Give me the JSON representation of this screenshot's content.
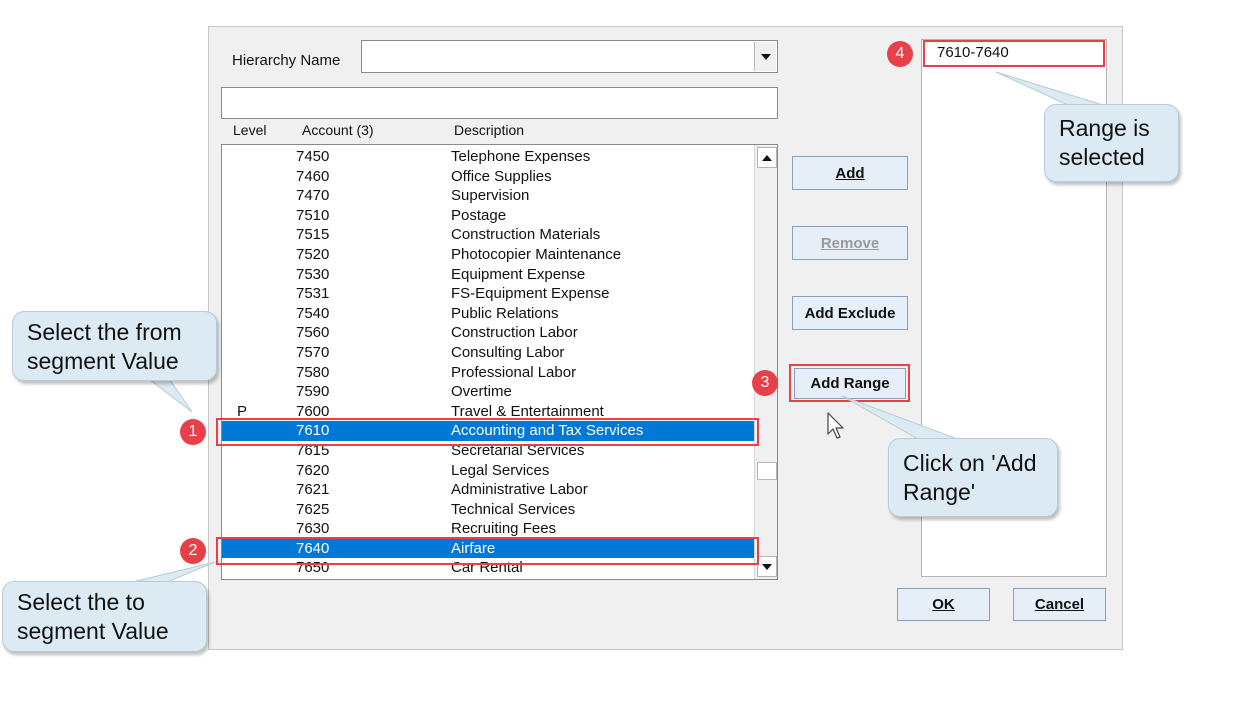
{
  "dialog": {
    "hierarchy_label": "Hierarchy Name",
    "hierarchy_value": "",
    "filter_value": "",
    "columns": {
      "level": "Level",
      "account": "Account (3)",
      "description": "Description"
    },
    "rows": [
      {
        "level": "",
        "account": "7450",
        "description": "Telephone Expenses",
        "selected": false
      },
      {
        "level": "",
        "account": "7460",
        "description": "Office Supplies",
        "selected": false
      },
      {
        "level": "",
        "account": "7470",
        "description": "Supervision",
        "selected": false
      },
      {
        "level": "",
        "account": "7510",
        "description": "Postage",
        "selected": false
      },
      {
        "level": "",
        "account": "7515",
        "description": "Construction Materials",
        "selected": false
      },
      {
        "level": "",
        "account": "7520",
        "description": "Photocopier Maintenance",
        "selected": false
      },
      {
        "level": "",
        "account": "7530",
        "description": "Equipment Expense",
        "selected": false
      },
      {
        "level": "",
        "account": "7531",
        "description": "FS-Equipment Expense",
        "selected": false
      },
      {
        "level": "",
        "account": "7540",
        "description": "Public Relations",
        "selected": false
      },
      {
        "level": "",
        "account": "7560",
        "description": "Construction Labor",
        "selected": false
      },
      {
        "level": "",
        "account": "7570",
        "description": "Consulting Labor",
        "selected": false
      },
      {
        "level": "",
        "account": "7580",
        "description": "Professional Labor",
        "selected": false
      },
      {
        "level": "",
        "account": "7590",
        "description": "Overtime",
        "selected": false
      },
      {
        "level": "P",
        "account": "7600",
        "description": "Travel & Entertainment",
        "selected": false
      },
      {
        "level": "",
        "account": "7610",
        "description": "Accounting and Tax Services",
        "selected": true
      },
      {
        "level": "",
        "account": "7615",
        "description": "Secretarial Services",
        "selected": false
      },
      {
        "level": "",
        "account": "7620",
        "description": "Legal Services",
        "selected": false
      },
      {
        "level": "",
        "account": "7621",
        "description": "Administrative Labor",
        "selected": false
      },
      {
        "level": "",
        "account": "7625",
        "description": "Technical Services",
        "selected": false
      },
      {
        "level": "",
        "account": "7630",
        "description": "Recruiting Fees",
        "selected": false
      },
      {
        "level": "",
        "account": "7640",
        "description": "Airfare",
        "selected": true
      },
      {
        "level": "",
        "account": "7650",
        "description": "Car Rental",
        "selected": false
      }
    ],
    "buttons": {
      "add": "Add",
      "remove": "Remove",
      "add_exclude": "Add Exclude",
      "add_range": "Add Range",
      "ok": "OK",
      "cancel": "Cancel"
    },
    "selected_items": [
      "7610-7640"
    ]
  },
  "annotations": {
    "step1": "1",
    "step2": "2",
    "step3": "3",
    "step4": "4",
    "callout_from": "Select the from segment Value",
    "callout_to": "Select the to segment Value",
    "callout_click": "Click on 'Add Range'",
    "callout_range": "Range is selected",
    "highlight_color": "#e8404a"
  },
  "colors": {
    "selection": "#0078d7",
    "dialog_bg": "#f0f0f0",
    "callout_bg": "#dcebf3"
  }
}
